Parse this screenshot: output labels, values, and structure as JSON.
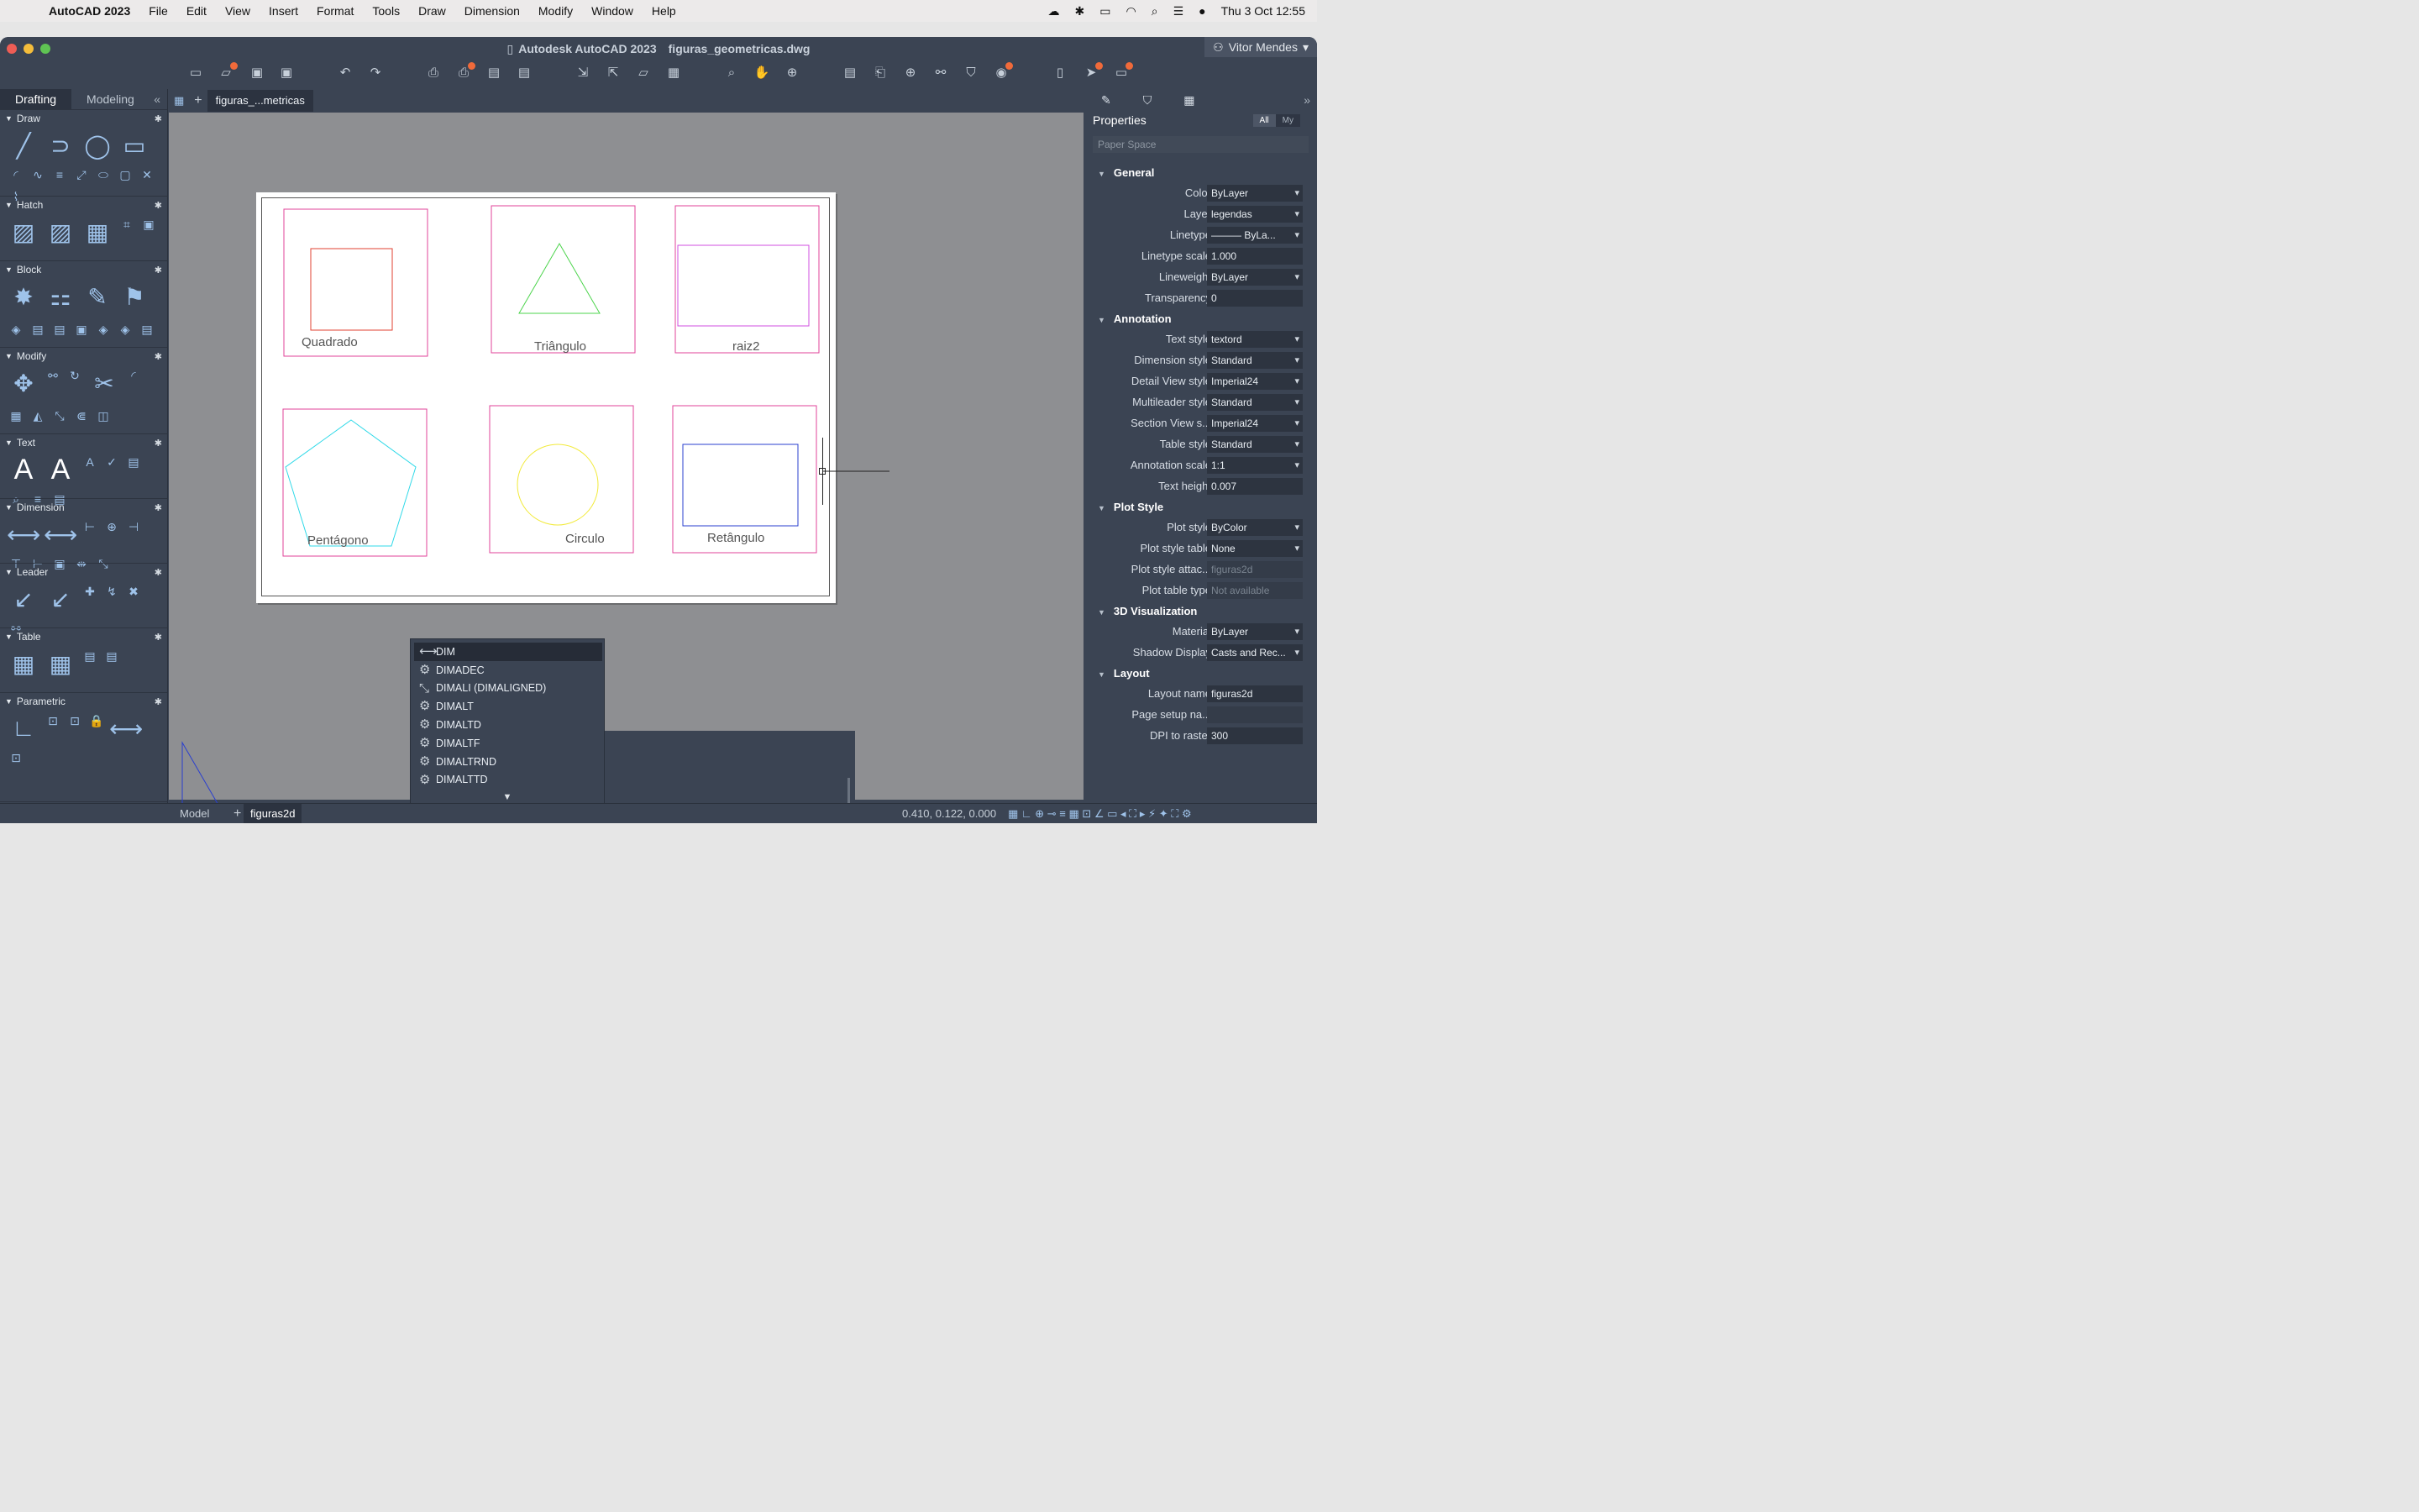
{
  "menubar": {
    "app": "AutoCAD 2023",
    "items": [
      "File",
      "Edit",
      "View",
      "Insert",
      "Format",
      "Tools",
      "Draw",
      "Dimension",
      "Modify",
      "Window",
      "Help"
    ],
    "clock": "Thu 3 Oct  12:55"
  },
  "window": {
    "title": "Autodesk AutoCAD 2023",
    "file": "figuras_geometricas.dwg",
    "user": "Vitor Mendes"
  },
  "palette": {
    "tabs": [
      "Drafting",
      "Modeling"
    ],
    "sections": [
      "Draw",
      "Hatch",
      "Block",
      "Modify",
      "Text",
      "Dimension",
      "Leader",
      "Table",
      "Parametric"
    ]
  },
  "doc": {
    "tab": "figuras_...metricas"
  },
  "drawing": {
    "labels": [
      "Quadrado",
      "Triângulo",
      "raiz2",
      "Pentágono",
      "Circulo",
      "Retângulo"
    ]
  },
  "autocomplete": {
    "items": [
      "DIM",
      "DIMADEC",
      "DIMALI (DIMALIGNED)",
      "DIMALT",
      "DIMALTD",
      "DIMALTF",
      "DIMALTRND",
      "DIMALTTD"
    ],
    "more": "▼"
  },
  "command": {
    "prompt": ">_",
    "value": "dim"
  },
  "bottom": {
    "model": "Model",
    "layout": "figuras2d",
    "coords": "0.410, 0.122, 0.000"
  },
  "properties": {
    "title": "Properties",
    "filter_all": "All",
    "filter_my": "My",
    "selection": "Paper Space",
    "groups": [
      {
        "name": "General",
        "rows": [
          [
            "Color",
            "ByLayer"
          ],
          [
            "Layer",
            "legendas"
          ],
          [
            "Linetype",
            "——— ByLa..."
          ],
          [
            "Linetype scale",
            "1.000"
          ],
          [
            "Lineweight",
            "ByLayer"
          ],
          [
            "Transparency",
            "0"
          ]
        ]
      },
      {
        "name": "Annotation",
        "rows": [
          [
            "Text style",
            "textord"
          ],
          [
            "Dimension style",
            "Standard"
          ],
          [
            "Detail View style",
            "Imperial24"
          ],
          [
            "Multileader style",
            "Standard"
          ],
          [
            "Section View s...",
            "Imperial24"
          ],
          [
            "Table style",
            "Standard"
          ],
          [
            "Annotation scale",
            "1:1"
          ],
          [
            "Text height",
            "0.007"
          ]
        ]
      },
      {
        "name": "Plot Style",
        "rows": [
          [
            "Plot style",
            "ByColor"
          ],
          [
            "Plot style table",
            "None"
          ],
          [
            "Plot style attac...",
            "figuras2d"
          ],
          [
            "Plot table type",
            "Not available"
          ]
        ]
      },
      {
        "name": "3D Visualization",
        "rows": [
          [
            "Material",
            "ByLayer"
          ],
          [
            "Shadow Display",
            "Casts and Rec..."
          ]
        ]
      },
      {
        "name": "Layout",
        "rows": [
          [
            "Layout name",
            "figuras2d"
          ],
          [
            "Page setup na...",
            ""
          ],
          [
            "DPI to raster",
            "300"
          ]
        ]
      }
    ]
  },
  "colors": {
    "accent": "#f06a3a",
    "panel": "#3b4453",
    "canvas": "#8e8f92"
  }
}
